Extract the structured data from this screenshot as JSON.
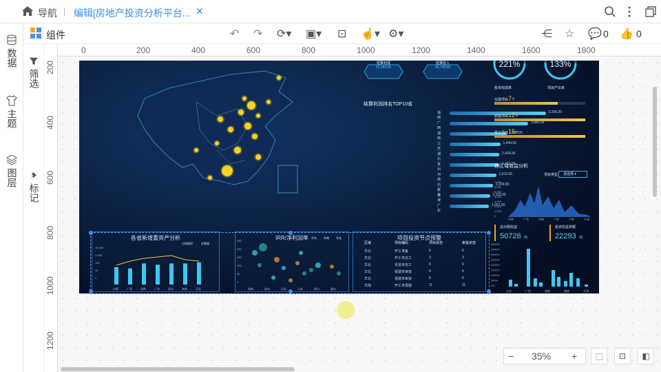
{
  "nav": {
    "label": "导航",
    "tab_title": "编辑[房地产投资分析平台...",
    "close": "✕"
  },
  "toolbar": {
    "components_label": "组件",
    "comment_count": "0",
    "like_count": "0"
  },
  "leftnav": {
    "data": "数据",
    "theme": "主题",
    "layers": "图层"
  },
  "leftnav2": {
    "filter": "筛选",
    "mark": "标记"
  },
  "ruler_h": [
    "0",
    "200",
    "400",
    "600",
    "800",
    "1000",
    "1200",
    "1400",
    "1600",
    "1800"
  ],
  "ruler_v": [
    "200",
    "400",
    "600",
    "800",
    "1000",
    "1200"
  ],
  "dashboard": {
    "kpi1_label": "结算利润",
    "kpi1_value": "22,293.00",
    "kpi2_label": "结算收入",
    "kpi2_value": "50,728.00",
    "pct1": "221%",
    "pct1_label": "投资完成率",
    "pct2": "133%",
    "pct2_label": "项目产出率",
    "ranking_title": "结算利润排名TOP10省",
    "ranking": [
      {
        "name": "海南",
        "value": "3,206.00",
        "pct": 0.93
      },
      {
        "name": "广西",
        "value": "2,582.00",
        "pct": 0.76
      },
      {
        "name": "湖南",
        "value": "1,637.00",
        "pct": 0.55
      },
      {
        "name": "江苏",
        "value": "1,444.00",
        "pct": 0.49
      },
      {
        "name": "湖北",
        "value": "1,424.00",
        "pct": 0.48
      },
      {
        "name": "贵州",
        "value": "1,421.00",
        "pct": 0.48
      },
      {
        "name": "河南",
        "value": "1,319.00",
        "pct": 0.45
      },
      {
        "name": "内蒙古",
        "value": "1,229.00",
        "pct": 0.42
      },
      {
        "name": "天津",
        "value": "1,119.00",
        "pct": 0.39
      },
      {
        "name": "广东",
        "value": "1,097.00",
        "pct": 0.38
      }
    ],
    "projects": [
      {
        "label": "在建项目",
        "count": "7",
        "unit": "个",
        "fill": 0.7
      },
      {
        "label": "新建项目",
        "count": "12",
        "unit": "个",
        "fill": 1.0
      },
      {
        "label": "竣工项目",
        "count": "15",
        "unit": "个",
        "fill": 1.0
      }
    ],
    "region_title": "各区域收益分析",
    "region_select": "请选择",
    "region_select_label": "项目类型",
    "region_y": [
      "7,000",
      "6,000",
      "5,000",
      "4,000",
      "3,000",
      "2,000",
      "1,000",
      "0"
    ],
    "region_x": [
      "华南",
      "广西",
      "河南",
      "江苏",
      "宁夏",
      "天津"
    ],
    "total_income_label": "总出租收益",
    "total_income": "50728",
    "total_income_unit": "元",
    "total_profit_label": "投资收益单额",
    "total_profit": "22293",
    "total_profit_unit": "元",
    "panel1_title": "各省新增重资产分析",
    "panel1_legend": [
      "占地面积",
      "总建面"
    ],
    "panel1_y": [
      "10,000",
      "1,000",
      "100",
      "10",
      "1"
    ],
    "panel1_x": [
      "内蒙",
      "广西",
      "湖南",
      "广东",
      "贵州",
      "海南",
      "河北"
    ],
    "panel2_title": "IRR/净利润率",
    "panel2_y": [
      "250",
      "200",
      "150",
      "100",
      "50",
      "0"
    ],
    "panel2_x": [
      "湖南",
      "贵州",
      "河北",
      "江苏",
      "四川",
      "重庆"
    ],
    "panel2_legend": [
      "华东",
      "华南",
      "华北"
    ],
    "panel3_title": "项目投资节点预警",
    "panel3_headers": [
      "区域",
      "项目编码",
      "项目状态",
      "审批状态"
    ],
    "panel3_rows": [
      [
        "华北",
        "开工准备",
        "6",
        "6"
      ],
      [
        "华北",
        "开工未完工",
        "3",
        "3"
      ],
      [
        "华北",
        "青苗未完工",
        "6",
        "6"
      ],
      [
        "华北",
        "报建未审批",
        "6",
        "6"
      ],
      [
        "华北",
        "报建未审批",
        "6",
        "6"
      ],
      [
        "华南",
        "开工未报建",
        "11",
        "11"
      ]
    ],
    "panel4_y": [
      "4000%",
      "3500%",
      "3000%",
      "2500%",
      "2000%",
      "1500%",
      "1000%",
      "500%",
      "0%"
    ],
    "panel4_x": [
      "江苏",
      "广西",
      "海南",
      "湖南",
      "天津"
    ]
  },
  "zoom": {
    "minus": "−",
    "value": "35%",
    "plus": "+"
  }
}
